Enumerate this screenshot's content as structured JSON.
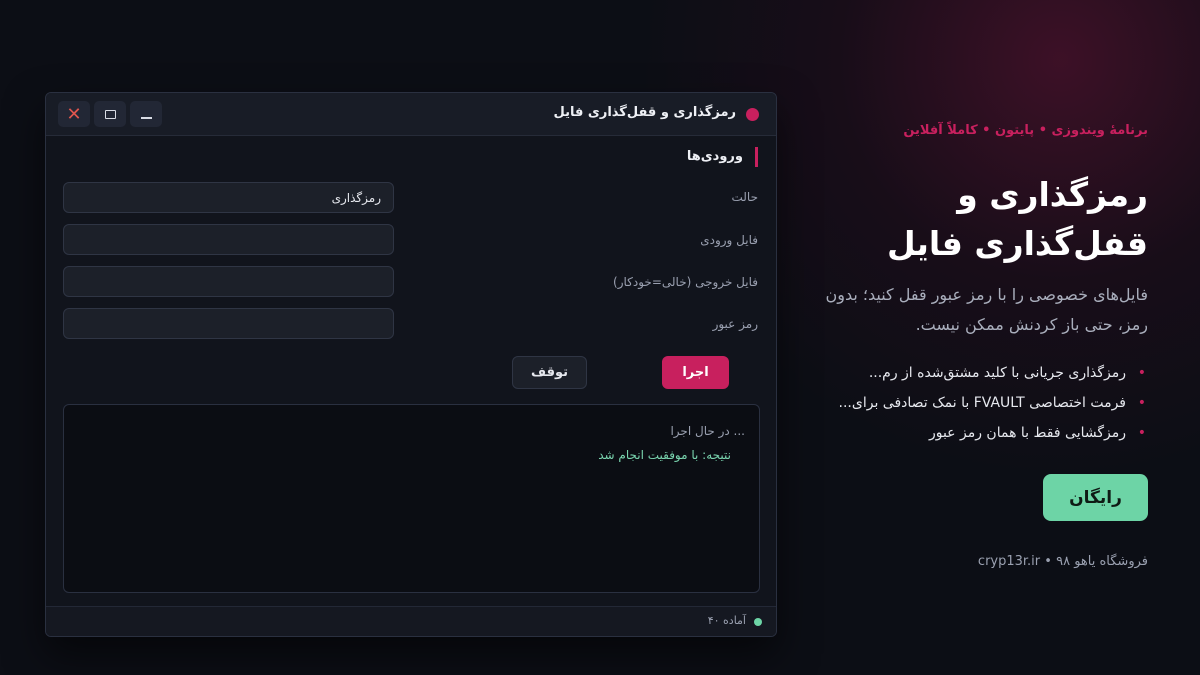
{
  "window": {
    "title": "رمزگذاری و قفل‌گذاری فایل",
    "section_title": "ورودی‌ها",
    "fields": [
      {
        "label": "حالت",
        "value": "رمزگذاری",
        "placeholder": ""
      },
      {
        "label": "فایل ورودی",
        "value": "",
        "placeholder": ""
      },
      {
        "label": "فایل خروجی (خالی=خودکار)",
        "value": "",
        "placeholder": ""
      },
      {
        "label": "رمز عبور",
        "value": "",
        "placeholder": ""
      }
    ],
    "run_label": "اجرا",
    "stop_label": "توقف",
    "log": [
      "... در حال اجرا",
      "نتیجه: با موفقیت انجام شد"
    ],
    "status_text": "آماده ۴۰",
    "colors": {
      "accent": "#c8205e",
      "success": "#6dd4a6",
      "close": "#e0564e"
    },
    "icons": {
      "close": "close-icon",
      "maximize": "maximize-icon",
      "minimize": "minimize-icon"
    }
  },
  "promo": {
    "kicker": "برنامهٔ ویندوزی • پایتون • کاملاً آفلاین",
    "headline": "رمزگذاری و قفل‌گذاری فایل",
    "subtitle": "فایل‌های خصوصی را با رمز عبور قفل کنید؛ بدون رمز، حتی باز کردنش ممکن نیست.",
    "features": [
      "رمزگذاری جریانی با کلید مشتق‌شده از رم...",
      "فرمت اختصاصی FVAULT با نمک تصادفی برای...",
      "رمزگشایی فقط با همان رمز عبور"
    ],
    "cta_label": "رایگان",
    "footer": "فروشگاه یاهو ۹۸ • cryp13r.ir"
  }
}
